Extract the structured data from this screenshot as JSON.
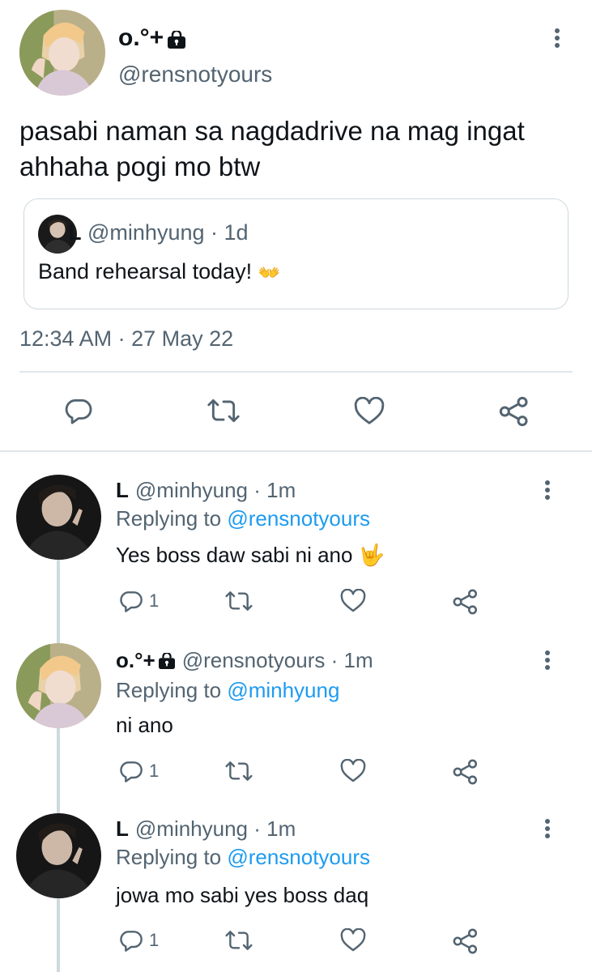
{
  "main_tweet": {
    "display_name": "o.°+",
    "handle": "@rensnotyours",
    "text": "pasabi naman sa nagdadrive na mag ingat ahhaha pogi mo btw",
    "quoted": {
      "display_name": "L",
      "handle": "@minhyung",
      "sep": "·",
      "age": "1d",
      "text": "Band rehearsal today! ",
      "emoji": "👐"
    },
    "timestamp": "12:34 AM · 27 May 22"
  },
  "replies": [
    {
      "display_name": "L",
      "handle": "@minhyung",
      "sep": "·",
      "age": "1m",
      "replying_prefix": "Replying to ",
      "replying_to": "@rensnotyours",
      "text": "Yes boss daw sabi ni ano ",
      "emoji": "🤟",
      "reply_count": "1"
    },
    {
      "display_name": "o.°+",
      "handle": "@rensnotyours",
      "sep": "·",
      "age": "1m",
      "replying_prefix": "Replying to ",
      "replying_to": "@minhyung",
      "text": "ni ano",
      "emoji": "",
      "reply_count": "1"
    },
    {
      "display_name": "L",
      "handle": "@minhyung",
      "sep": "·",
      "age": "1m",
      "replying_prefix": "Replying to ",
      "replying_to": "@rensnotyours",
      "text": "jowa mo sabi yes boss daq",
      "emoji": "",
      "reply_count": "1"
    }
  ],
  "icons": {
    "reply": "reply-icon",
    "retweet": "retweet-icon",
    "like": "heart-icon",
    "share": "share-icon",
    "more": "more-options-icon",
    "lock": "lock-icon"
  },
  "colors": {
    "link": "#1d9bf0",
    "secondary_text": "#536471",
    "icon": "#536471",
    "divider": "#e1e6ea"
  }
}
